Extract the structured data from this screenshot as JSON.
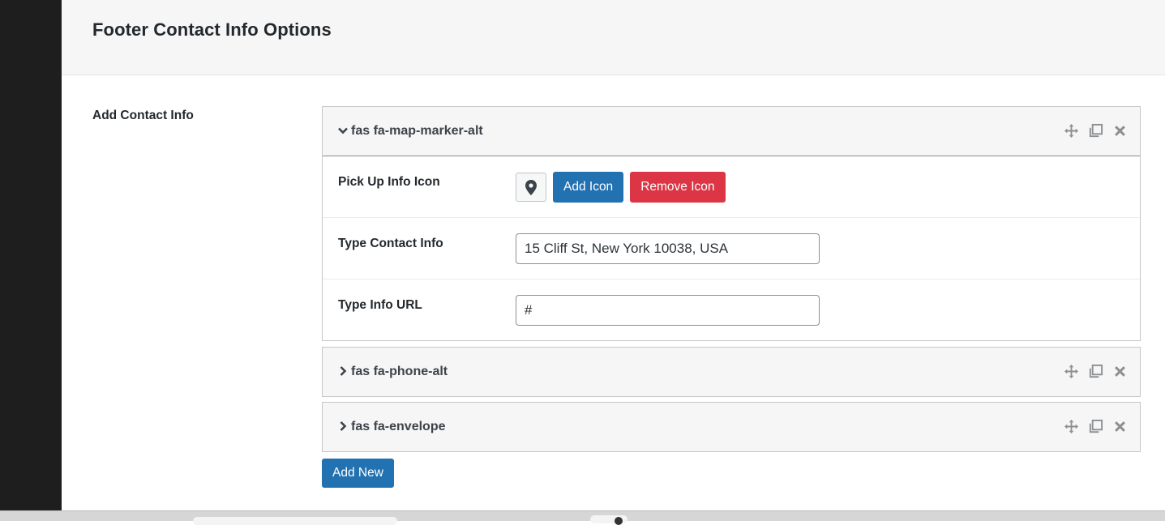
{
  "panel": {
    "title": "Footer Contact Info Options",
    "field_label": "Add Contact Info"
  },
  "groups": [
    {
      "title": "fas fa-map-marker-alt",
      "expanded": true,
      "toggle_icon": "chevron-down-icon",
      "fields": {
        "icon_label": "Pick Up Info Icon",
        "icon_preview": "map-marker-icon",
        "add_icon_label": "Add Icon",
        "remove_icon_label": "Remove Icon",
        "contact_label": "Type Contact Info",
        "contact_value": "15 Cliff St, New York 10038, USA",
        "url_label": "Type Info URL",
        "url_value": "#"
      }
    },
    {
      "title": "fas fa-phone-alt",
      "expanded": false,
      "toggle_icon": "chevron-right-icon"
    },
    {
      "title": "fas fa-envelope",
      "expanded": false,
      "toggle_icon": "chevron-right-icon"
    }
  ],
  "add_new_label": "Add New",
  "colors": {
    "primary": "#2271b1",
    "danger": "#dc3545",
    "header_bg": "#f6f6f6",
    "sidebar_dark": "#1e1e1e"
  }
}
